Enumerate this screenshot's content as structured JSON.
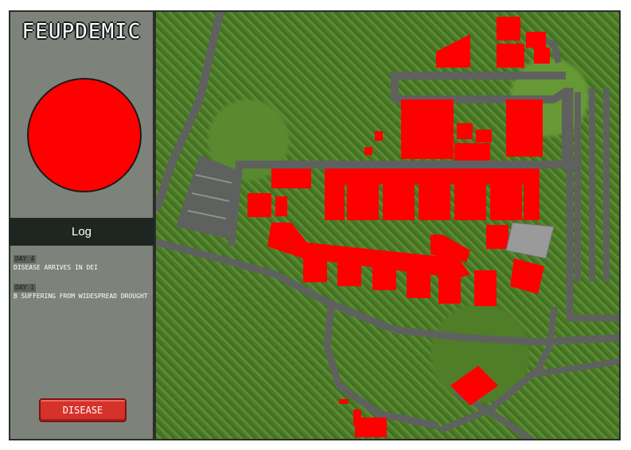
{
  "app": {
    "title": "FEUPDEMIC"
  },
  "log": {
    "header": "Log",
    "entries": [
      {
        "day": "DAY 4",
        "text": "DISEASE ARRIVES IN DEI"
      },
      {
        "day": "DAY 1",
        "text": "B SUFFERING FROM WIDESPREAD DROUGHT"
      }
    ]
  },
  "buttons": {
    "disease_label": "DISEASE"
  },
  "colors": {
    "infected": "#ff0000",
    "road": "#5f615f",
    "panel": "#7d837b",
    "grass": "#4f7f29",
    "button": "#d6312a",
    "uninfected_building": "#9a9a9a"
  },
  "map": {
    "icons": [
      "globe-icon"
    ]
  }
}
